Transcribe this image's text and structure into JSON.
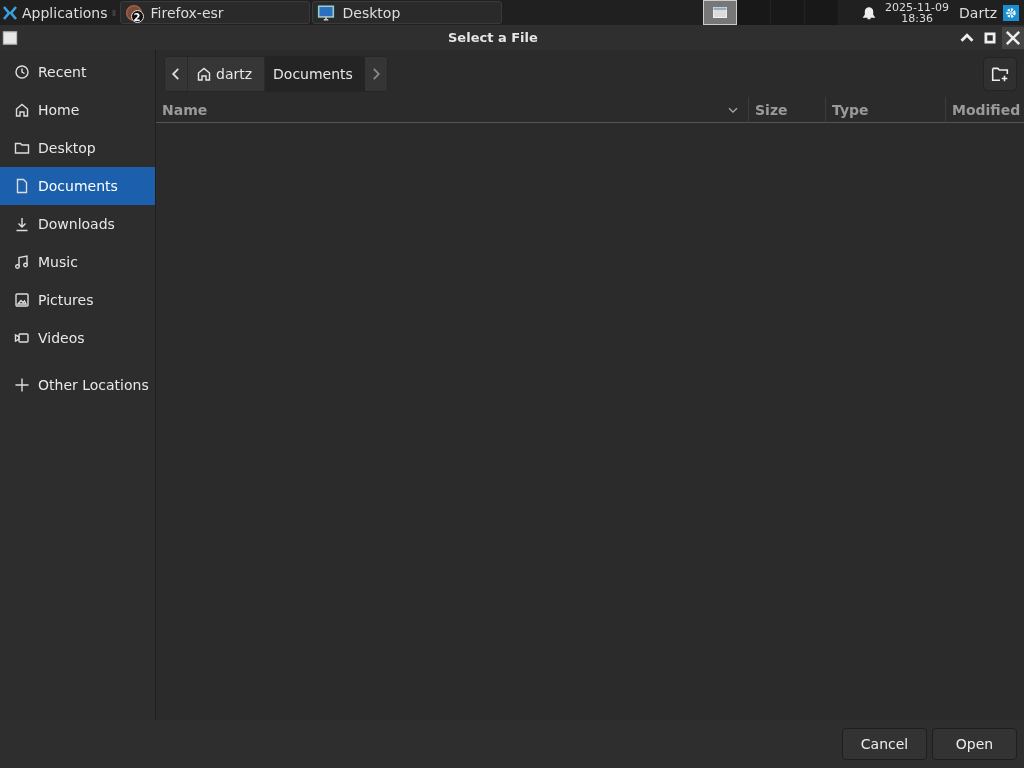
{
  "taskbar": {
    "apps_menu": "Applications",
    "tasks": [
      {
        "label": "Firefox-esr",
        "badge": "2",
        "kind": "browser"
      },
      {
        "label": "Desktop",
        "kind": "desktop"
      }
    ],
    "workspaces": [
      {
        "selected": true
      },
      {
        "selected": false
      },
      {
        "selected": false
      },
      {
        "selected": false
      }
    ],
    "clock": {
      "date": "2025-11-09",
      "time": "18:36"
    },
    "user": "Dartz"
  },
  "window": {
    "title": "Select a File"
  },
  "sidebar": {
    "items": [
      {
        "label": "Recent",
        "kind": "clock",
        "selected": false
      },
      {
        "label": "Home",
        "kind": "home",
        "selected": false
      },
      {
        "label": "Desktop",
        "kind": "folder",
        "selected": false
      },
      {
        "label": "Documents",
        "kind": "document",
        "selected": true
      },
      {
        "label": "Downloads",
        "kind": "download",
        "selected": false
      },
      {
        "label": "Music",
        "kind": "music",
        "selected": false
      },
      {
        "label": "Pictures",
        "kind": "picture",
        "selected": false
      },
      {
        "label": "Videos",
        "kind": "video",
        "selected": false
      },
      {
        "label": "Other Locations",
        "kind": "plus",
        "selected": false
      }
    ]
  },
  "path_bar": {
    "segments": [
      {
        "label": "dartz",
        "kind": "home",
        "selected": false
      },
      {
        "label": "Documents",
        "kind": "folder",
        "selected": true
      }
    ]
  },
  "file_list": {
    "columns": [
      {
        "label": "Name",
        "sorted": true
      },
      {
        "label": "Size",
        "sorted": false
      },
      {
        "label": "Type",
        "sorted": false
      },
      {
        "label": "Modified",
        "sorted": false
      }
    ]
  },
  "buttons": [
    {
      "label": "Cancel"
    },
    {
      "label": "Open"
    }
  ]
}
